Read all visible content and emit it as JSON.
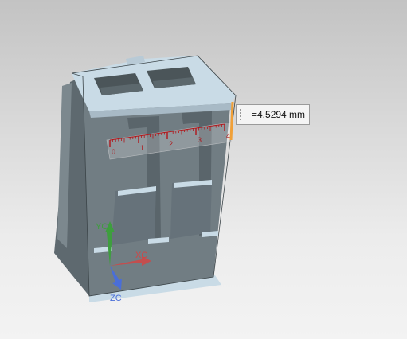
{
  "measurement": {
    "value": "=4.5294 mm"
  },
  "ruler": {
    "labels": [
      "0",
      "1",
      "2",
      "3",
      "4"
    ]
  },
  "triad": {
    "xc": "XC",
    "yc": "YC",
    "zc": "ZC"
  },
  "colors": {
    "background_top": "#c3c3c3",
    "background_bottom": "#f3f3f3",
    "model_face": "#717d83",
    "model_top": "#c9dbe6",
    "ruler": "#b0161a",
    "measure_edge": "#f0a038",
    "axis_x": "#d14545",
    "axis_y": "#3e9e3e",
    "axis_z": "#4a6ed8"
  }
}
